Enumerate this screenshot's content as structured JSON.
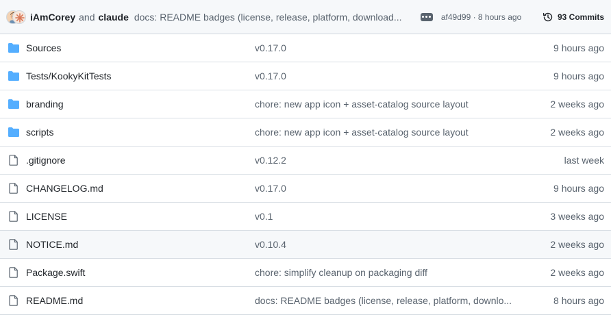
{
  "header": {
    "authors": [
      "iAmCorey",
      "claude"
    ],
    "and_text": "and",
    "commit_message": "docs: README badges (license, release, platform, download...",
    "sha_and_time": "af49d99 · 8 hours ago",
    "commits_label": "93 Commits"
  },
  "files": [
    {
      "name": "Sources",
      "type": "folder",
      "message": "v0.17.0",
      "date": "9 hours ago"
    },
    {
      "name": "Tests/KookyKitTests",
      "type": "folder",
      "message": "v0.17.0",
      "date": "9 hours ago"
    },
    {
      "name": "branding",
      "type": "folder",
      "message": "chore: new app icon + asset-catalog source layout",
      "date": "2 weeks ago"
    },
    {
      "name": "scripts",
      "type": "folder",
      "message": "chore: new app icon + asset-catalog source layout",
      "date": "2 weeks ago"
    },
    {
      "name": ".gitignore",
      "type": "file",
      "message": "v0.12.2",
      "date": "last week"
    },
    {
      "name": "CHANGELOG.md",
      "type": "file",
      "message": "v0.17.0",
      "date": "9 hours ago"
    },
    {
      "name": "LICENSE",
      "type": "file",
      "message": "v0.1",
      "date": "3 weeks ago"
    },
    {
      "name": "NOTICE.md",
      "type": "file",
      "message": "v0.10.4",
      "date": "2 weeks ago"
    },
    {
      "name": "Package.swift",
      "type": "file",
      "message": "chore: simplify cleanup on packaging diff",
      "date": "2 weeks ago"
    },
    {
      "name": "README.md",
      "type": "file",
      "message": "docs: README badges (license, release, platform, downlo...",
      "date": "8 hours ago"
    }
  ],
  "colors": {
    "folder": "#54aeff",
    "muted": "#59636e",
    "border": "#d0d7de"
  }
}
